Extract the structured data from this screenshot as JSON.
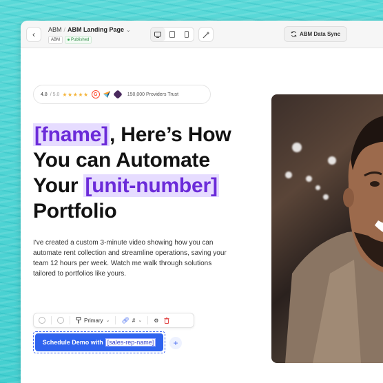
{
  "topbar": {
    "breadcrumb_root": "ABM",
    "breadcrumb_sep": "/",
    "page_name": "ABM Landing Page",
    "tag_abm": "ABM",
    "tag_published": "Published",
    "sync_label": "ABM Data Sync"
  },
  "rating": {
    "score": "4.8",
    "out_of": "/ 5.0",
    "stars": "★★★★★",
    "trust_text": "150,000 Providers Trust"
  },
  "headline": {
    "var_fname": "[fname]",
    "line1_rest": ", Here’s How",
    "line2": "You can Automate",
    "line3_prefix": "Your",
    "var_unit": "[unit-number]",
    "line4": "Portfolio"
  },
  "body_text": "I've created a custom 3-minute video showing how you can automate rent collection and streamline operations, saving your team 12 hours per week. Watch me walk through solutions tailored to portfolios like yours.",
  "toolbar": {
    "style_label": "Primary",
    "link_label": "#"
  },
  "cta": {
    "label": "Schedule Demo with",
    "var_rep": "[sales-rep-name]"
  },
  "colors": {
    "accent_blue": "#2f63ee",
    "variable_purple": "#6b2bd9",
    "variable_bg": "#e6dcff",
    "published_green": "#34a853",
    "background_teal": "#4fd6d6"
  }
}
